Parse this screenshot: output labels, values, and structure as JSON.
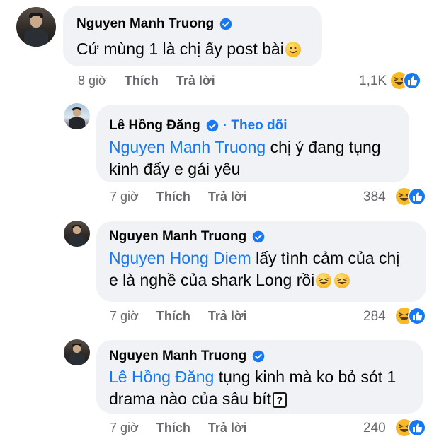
{
  "comments": [
    {
      "author": "Nguyen Manh Truong",
      "mention": "",
      "lines": [
        "Cứ mùng 1 là chị ấy post bài"
      ],
      "time": "8 giờ",
      "like": "Thích",
      "reply": "Trả lời",
      "reactions": "1,1K"
    },
    {
      "author": "Lê Hồng Đăng",
      "follow": "· Theo dõi",
      "mention": "Nguyen Manh Truong",
      "lines": [
        " chị ý đang tụng",
        "kinh đấy e gái yêu"
      ],
      "time": "7 giờ",
      "like": "Thích",
      "reply": "Trả lời",
      "reactions": "384"
    },
    {
      "author": "Nguyen Manh Truong",
      "mention": "Nguyen Hong Diem",
      "lines": [
        " lấy tình cảm của chị",
        "e là nghề của shark Long rồi"
      ],
      "time": "7 giờ",
      "like": "Thích",
      "reply": "Trả lời",
      "reactions": "284"
    },
    {
      "author": "Nguyen Manh Truong",
      "mention": "Lê Hồng Đăng",
      "lines": [
        " tụng kinh mà ko bỏ sót 1",
        "drama nào của sâu bít"
      ],
      "time": "7 giờ",
      "like": "Thích",
      "reply": "Trả lời",
      "reactions": "240"
    }
  ],
  "colors": {
    "bubble": "#f0f2f5",
    "link": "#1877f2",
    "meta": "#65676b",
    "like_blue": "#1877f2",
    "haha_yellow": "#f7b928"
  }
}
